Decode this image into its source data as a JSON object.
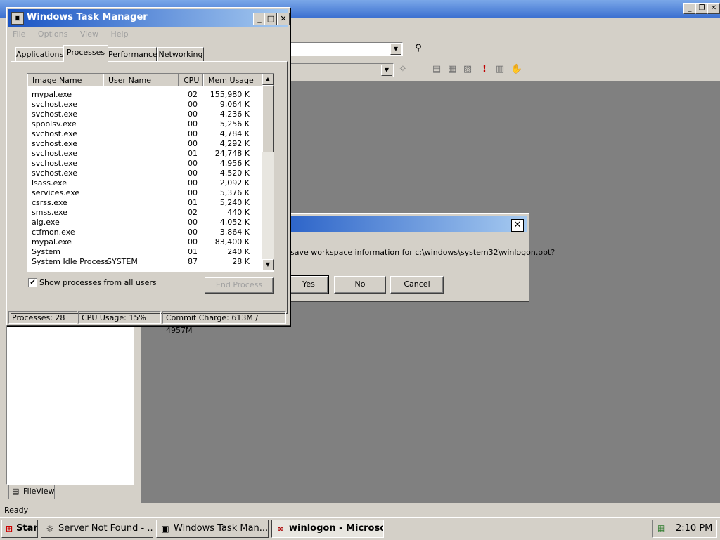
{
  "taskmanager": {
    "title": "Windows Task Manager",
    "menu": [
      "File",
      "Options",
      "View",
      "Help"
    ],
    "tabs": [
      "Applications",
      "Processes",
      "Performance",
      "Networking"
    ],
    "selected_tab": "Processes",
    "columns": [
      "Image Name",
      "User Name",
      "CPU",
      "Mem Usage"
    ],
    "processes": [
      {
        "name": "mypal.exe",
        "user": "",
        "cpu": "02",
        "mem": "155,980 K"
      },
      {
        "name": "svchost.exe",
        "user": "",
        "cpu": "00",
        "mem": "9,064 K"
      },
      {
        "name": "svchost.exe",
        "user": "",
        "cpu": "00",
        "mem": "4,236 K"
      },
      {
        "name": "spoolsv.exe",
        "user": "",
        "cpu": "00",
        "mem": "5,256 K"
      },
      {
        "name": "svchost.exe",
        "user": "",
        "cpu": "00",
        "mem": "4,784 K"
      },
      {
        "name": "svchost.exe",
        "user": "",
        "cpu": "00",
        "mem": "4,292 K"
      },
      {
        "name": "svchost.exe",
        "user": "",
        "cpu": "01",
        "mem": "24,748 K"
      },
      {
        "name": "svchost.exe",
        "user": "",
        "cpu": "00",
        "mem": "4,956 K"
      },
      {
        "name": "svchost.exe",
        "user": "",
        "cpu": "00",
        "mem": "4,520 K"
      },
      {
        "name": "lsass.exe",
        "user": "",
        "cpu": "00",
        "mem": "2,092 K"
      },
      {
        "name": "services.exe",
        "user": "",
        "cpu": "00",
        "mem": "5,376 K"
      },
      {
        "name": "csrss.exe",
        "user": "",
        "cpu": "01",
        "mem": "5,240 K"
      },
      {
        "name": "smss.exe",
        "user": "",
        "cpu": "02",
        "mem": "440 K"
      },
      {
        "name": "alg.exe",
        "user": "",
        "cpu": "00",
        "mem": "4,052 K"
      },
      {
        "name": "ctfmon.exe",
        "user": "",
        "cpu": "00",
        "mem": "3,864 K"
      },
      {
        "name": "mypal.exe",
        "user": "",
        "cpu": "00",
        "mem": "83,400 K"
      },
      {
        "name": "System",
        "user": "",
        "cpu": "01",
        "mem": "240 K"
      },
      {
        "name": "System Idle Process",
        "user": "SYSTEM",
        "cpu": "87",
        "mem": "28 K"
      }
    ],
    "show_all_label": "Show processes from all users",
    "show_all_checked": true,
    "end_process_label": "End Process",
    "status": {
      "processes": "Processes: 28",
      "cpu": "CPU Usage: 15%",
      "commit": "Commit Charge: 613M / 4957M"
    }
  },
  "dialog": {
    "message": "save workspace information for c:\\windows\\system32\\winlogon.opt?",
    "yes": "Yes",
    "no": "No",
    "cancel": "Cancel"
  },
  "ide": {
    "status": "Ready",
    "fileview_tab": "FileView"
  },
  "taskbar": {
    "start": "Start",
    "items": [
      {
        "label": "Server Not Found - ...",
        "active": false
      },
      {
        "label": "Windows Task Man...",
        "active": false
      },
      {
        "label": "winlogon - Microso...",
        "active": true
      }
    ],
    "clock": "2:10 PM"
  }
}
